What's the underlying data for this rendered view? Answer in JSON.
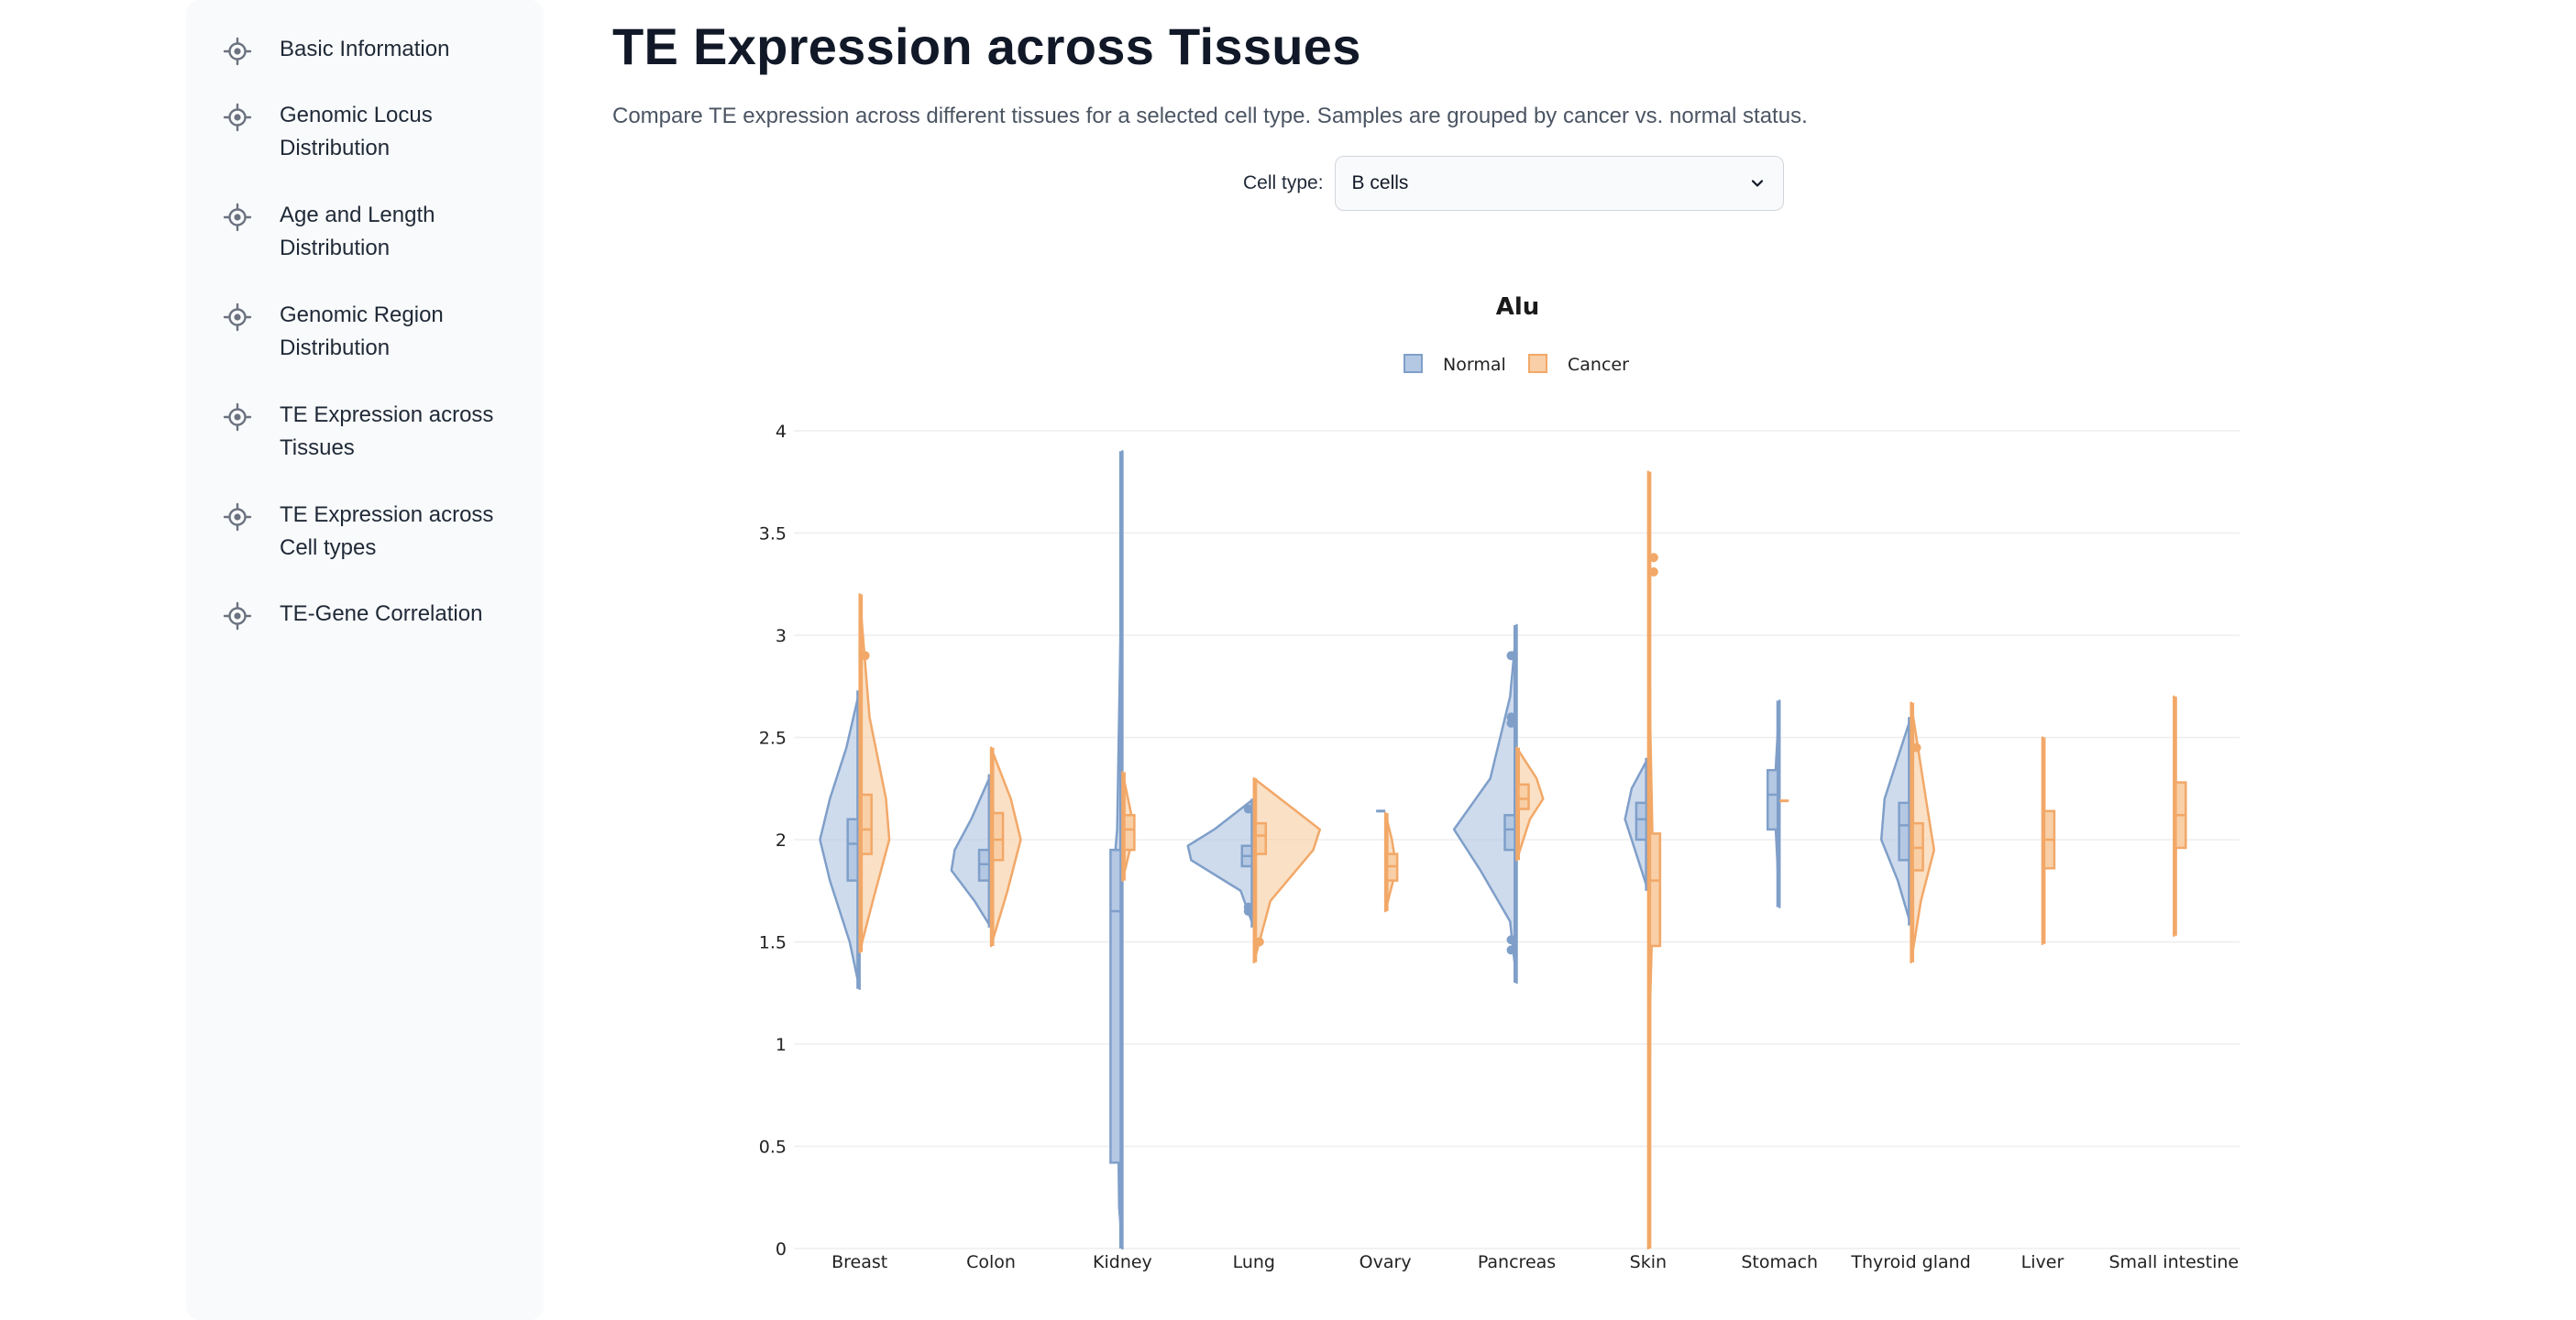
{
  "sidebar": {
    "items": [
      {
        "label": "Basic Information"
      },
      {
        "label": "Genomic Locus Distribution"
      },
      {
        "label": "Age and Length Distribution"
      },
      {
        "label": "Genomic Region Distribution"
      },
      {
        "label": "TE Expression across Tissues"
      },
      {
        "label": "TE Expression across Cell types"
      },
      {
        "label": "TE-Gene Correlation"
      }
    ],
    "icon": "target-icon"
  },
  "page": {
    "title": "TE Expression across Tissues",
    "description": "Compare TE expression across different tissues for a selected cell type. Samples are grouped by cancer vs. normal status."
  },
  "filter": {
    "label": "Cell type:",
    "selected": "B cells"
  },
  "colors": {
    "normal": "#7f9fc9",
    "normal_fill": "#b4c8e3",
    "cancer": "#f2a868",
    "cancer_fill": "#f8cfa6",
    "grid": "#eeeeee"
  },
  "chart_data": {
    "type": "violin",
    "title": "Alu",
    "xlabel": "",
    "ylabel": "",
    "ylim": [
      0,
      4
    ],
    "yticks": [
      0,
      0.5,
      1,
      1.5,
      2,
      2.5,
      3,
      3.5,
      4
    ],
    "grid": true,
    "legend_position": "top-center",
    "categories": [
      "Breast",
      "Colon",
      "Kidney",
      "Lung",
      "Ovary",
      "Pancreas",
      "Skin",
      "Stomach",
      "Thyroid gland",
      "Liver",
      "Small intestine"
    ],
    "series": [
      {
        "name": "Normal",
        "side": "negative",
        "violins": [
          {
            "tissue": "Breast",
            "min": 1.27,
            "q1": 1.8,
            "median": 1.98,
            "q3": 2.1,
            "max": 2.73,
            "outliers": [],
            "profile": [
              [
                1.27,
                0
              ],
              [
                1.5,
                0.15
              ],
              [
                1.8,
                0.45
              ],
              [
                2.0,
                0.6
              ],
              [
                2.2,
                0.45
              ],
              [
                2.45,
                0.2
              ],
              [
                2.73,
                0
              ]
            ]
          },
          {
            "tissue": "Colon",
            "min": 1.57,
            "q1": 1.8,
            "median": 1.88,
            "q3": 1.95,
            "max": 2.32,
            "outliers": [],
            "profile": [
              [
                1.57,
                0
              ],
              [
                1.7,
                0.25
              ],
              [
                1.85,
                0.6
              ],
              [
                1.95,
                0.55
              ],
              [
                2.1,
                0.3
              ],
              [
                2.32,
                0
              ]
            ]
          },
          {
            "tissue": "Kidney",
            "min": 0,
            "q1": 0.42,
            "median": 1.65,
            "q3": 1.95,
            "max": 3.9,
            "outliers": [],
            "profile": [
              [
                0,
                0
              ],
              [
                0.2,
                0.05
              ],
              [
                1.0,
                0.08
              ],
              [
                1.9,
                0.12
              ],
              [
                2.05,
                0.08
              ],
              [
                3.0,
                0.03
              ],
              [
                3.9,
                0
              ]
            ]
          },
          {
            "tissue": "Lung",
            "min": 1.57,
            "q1": 1.87,
            "median": 1.92,
            "q3": 1.97,
            "max": 2.2,
            "outliers": [
              2.15,
              1.67,
              1.65
            ],
            "profile": [
              [
                1.57,
                0
              ],
              [
                1.75,
                0.2
              ],
              [
                1.9,
                0.95
              ],
              [
                1.97,
                1.0
              ],
              [
                2.05,
                0.6
              ],
              [
                2.2,
                0
              ]
            ]
          },
          {
            "tissue": "Ovary",
            "min": 2.14,
            "q1": 2.14,
            "median": 2.14,
            "q3": 2.14,
            "max": 2.14,
            "outliers": [],
            "profile": [
              [
                2.14,
                0
              ]
            ]
          },
          {
            "tissue": "Pancreas",
            "min": 1.3,
            "q1": 1.95,
            "median": 2.05,
            "q3": 2.12,
            "max": 3.05,
            "outliers": [
              2.9,
              2.6,
              2.57,
              1.51,
              1.46
            ],
            "profile": [
              [
                1.3,
                0
              ],
              [
                1.6,
                0.1
              ],
              [
                1.85,
                0.55
              ],
              [
                2.05,
                0.95
              ],
              [
                2.3,
                0.4
              ],
              [
                2.7,
                0.1
              ],
              [
                3.05,
                0
              ]
            ]
          },
          {
            "tissue": "Skin",
            "min": 1.75,
            "q1": 2.0,
            "median": 2.1,
            "q3": 2.18,
            "max": 2.4,
            "outliers": [],
            "profile": [
              [
                1.75,
                0
              ],
              [
                1.9,
                0.15
              ],
              [
                2.1,
                0.35
              ],
              [
                2.25,
                0.25
              ],
              [
                2.4,
                0
              ]
            ]
          },
          {
            "tissue": "Stomach",
            "min": 1.67,
            "q1": 2.05,
            "median": 2.22,
            "q3": 2.34,
            "max": 2.68,
            "outliers": [],
            "profile": [
              [
                1.67,
                0
              ],
              [
                2.0,
                0.05
              ],
              [
                2.2,
                0.08
              ],
              [
                2.4,
                0.05
              ],
              [
                2.68,
                0
              ]
            ]
          },
          {
            "tissue": "Thyroid gland",
            "min": 1.58,
            "q1": 1.9,
            "median": 2.07,
            "q3": 2.18,
            "max": 2.6,
            "outliers": [],
            "profile": [
              [
                1.58,
                0
              ],
              [
                1.8,
                0.2
              ],
              [
                2.0,
                0.45
              ],
              [
                2.2,
                0.4
              ],
              [
                2.45,
                0.15
              ],
              [
                2.6,
                0
              ]
            ]
          }
        ]
      },
      {
        "name": "Cancer",
        "side": "positive",
        "violins": [
          {
            "tissue": "Breast",
            "min": 1.45,
            "q1": 1.93,
            "median": 2.05,
            "q3": 2.22,
            "max": 3.2,
            "outliers": [
              2.9
            ],
            "profile": [
              [
                1.45,
                0
              ],
              [
                1.7,
                0.2
              ],
              [
                2.0,
                0.45
              ],
              [
                2.2,
                0.4
              ],
              [
                2.6,
                0.15
              ],
              [
                3.2,
                0
              ]
            ]
          },
          {
            "tissue": "Colon",
            "min": 1.48,
            "q1": 1.9,
            "median": 2.0,
            "q3": 2.13,
            "max": 2.45,
            "outliers": [],
            "profile": [
              [
                1.48,
                0
              ],
              [
                1.75,
                0.25
              ],
              [
                2.0,
                0.45
              ],
              [
                2.2,
                0.3
              ],
              [
                2.45,
                0
              ]
            ]
          },
          {
            "tissue": "Kidney",
            "min": 1.8,
            "q1": 1.95,
            "median": 2.05,
            "q3": 2.12,
            "max": 2.33,
            "outliers": [],
            "profile": [
              [
                1.8,
                0
              ],
              [
                2.0,
                0.15
              ],
              [
                2.1,
                0.15
              ],
              [
                2.33,
                0
              ]
            ]
          },
          {
            "tissue": "Lung",
            "min": 1.4,
            "q1": 1.93,
            "median": 2.02,
            "q3": 2.08,
            "max": 2.3,
            "outliers": [
              1.5
            ],
            "profile": [
              [
                1.4,
                0
              ],
              [
                1.7,
                0.25
              ],
              [
                1.95,
                0.9
              ],
              [
                2.05,
                1.0
              ],
              [
                2.15,
                0.6
              ],
              [
                2.3,
                0
              ]
            ]
          },
          {
            "tissue": "Ovary",
            "min": 1.65,
            "q1": 1.8,
            "median": 1.87,
            "q3": 1.93,
            "max": 2.13,
            "outliers": [],
            "profile": [
              [
                1.65,
                0
              ],
              [
                1.8,
                0.12
              ],
              [
                1.9,
                0.15
              ],
              [
                2.0,
                0.1
              ],
              [
                2.13,
                0
              ]
            ]
          },
          {
            "tissue": "Pancreas",
            "min": 1.9,
            "q1": 2.15,
            "median": 2.2,
            "q3": 2.27,
            "max": 2.45,
            "outliers": [],
            "profile": [
              [
                1.9,
                0
              ],
              [
                2.1,
                0.2
              ],
              [
                2.2,
                0.4
              ],
              [
                2.3,
                0.3
              ],
              [
                2.45,
                0
              ]
            ]
          },
          {
            "tissue": "Skin",
            "min": 0,
            "q1": 1.48,
            "median": 1.8,
            "q3": 2.03,
            "max": 3.8,
            "outliers": [
              3.38,
              3.31
            ],
            "profile": [
              [
                0,
                0
              ],
              [
                0.5,
                0.02
              ],
              [
                1.2,
                0.03
              ],
              [
                1.8,
                0.08
              ],
              [
                2.1,
                0.06
              ],
              [
                2.6,
                0.03
              ],
              [
                3.8,
                0
              ]
            ]
          },
          {
            "tissue": "Stomach",
            "min": 2.19,
            "q1": 2.19,
            "median": 2.19,
            "q3": 2.19,
            "max": 2.19,
            "outliers": [],
            "profile": [
              [
                2.19,
                0
              ]
            ]
          },
          {
            "tissue": "Thyroid gland",
            "min": 1.4,
            "q1": 1.85,
            "median": 1.96,
            "q3": 2.08,
            "max": 2.67,
            "outliers": [
              2.45
            ],
            "profile": [
              [
                1.4,
                0
              ],
              [
                1.7,
                0.15
              ],
              [
                1.95,
                0.35
              ],
              [
                2.15,
                0.25
              ],
              [
                2.67,
                0
              ]
            ]
          },
          {
            "tissue": "Liver",
            "min": 1.49,
            "q1": 1.86,
            "median": 2.0,
            "q3": 2.14,
            "max": 2.5,
            "outliers": [],
            "profile": [
              [
                1.49,
                0
              ],
              [
                2.0,
                0.03
              ],
              [
                2.5,
                0
              ]
            ]
          },
          {
            "tissue": "Small intestine",
            "min": 1.53,
            "q1": 1.96,
            "median": 2.12,
            "q3": 2.28,
            "max": 2.7,
            "outliers": [],
            "profile": [
              [
                1.53,
                0
              ],
              [
                2.1,
                0.04
              ],
              [
                2.7,
                0
              ]
            ]
          }
        ]
      }
    ]
  }
}
